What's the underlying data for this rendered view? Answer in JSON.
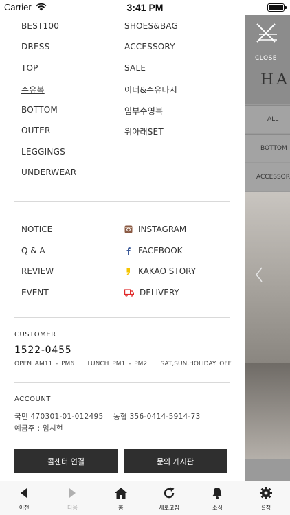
{
  "status_bar": {
    "carrier": "Carrier",
    "time": "3:41 PM"
  },
  "categories": {
    "left": [
      "BEST100",
      "DRESS",
      "TOP",
      "수유복",
      "BOTTOM",
      "OUTER",
      "LEGGINGS",
      "UNDERWEAR"
    ],
    "right": [
      "SHOES&BAG",
      "ACCESSORY",
      "SALE",
      "이너&수유나시",
      "임부수영복",
      "위아래SET"
    ]
  },
  "links": {
    "left": [
      "NOTICE",
      "Q & A",
      "REVIEW",
      "EVENT"
    ],
    "sns": [
      {
        "label": "INSTAGRAM",
        "icon": "instagram-icon"
      },
      {
        "label": "FACEBOOK",
        "icon": "facebook-icon"
      },
      {
        "label": "KAKAO STORY",
        "icon": "kakao-story-icon"
      },
      {
        "label": "DELIVERY",
        "icon": "delivery-truck-icon"
      }
    ]
  },
  "customer": {
    "label": "CUSTOMER",
    "phone": "1522-0455",
    "hours": "OPEN AM11 - PM6    LUNCH PM1 - PM2    SAT,SUN,HOLIDAY OFF"
  },
  "account": {
    "label": "ACCOUNT",
    "numbers": "국민 470301-01-012495    농협 356-0414-5914-73",
    "holder": "예금주 : 임시현"
  },
  "buttons": {
    "call_center": "콜센터 연결",
    "inquiry_board": "문의 게시판"
  },
  "background": {
    "close_label": "CLOSE",
    "brand_partial": "HAF",
    "tabs": [
      "ALL",
      "BOTTOM",
      "ACCESSORY"
    ]
  },
  "toolbar": {
    "items": [
      {
        "label": "이전",
        "icon": "back-arrow-icon"
      },
      {
        "label": "다음",
        "icon": "forward-arrow-icon"
      },
      {
        "label": "홈",
        "icon": "home-icon"
      },
      {
        "label": "새로고침",
        "icon": "refresh-icon"
      },
      {
        "label": "소식",
        "icon": "bell-icon"
      },
      {
        "label": "설정",
        "icon": "gear-icon"
      }
    ]
  },
  "colors": {
    "button_dark": "#2f2f2f",
    "instagram": "#8a5a44",
    "facebook": "#3b5998",
    "kakao": "#f5c400",
    "delivery": "#e02a2a"
  }
}
